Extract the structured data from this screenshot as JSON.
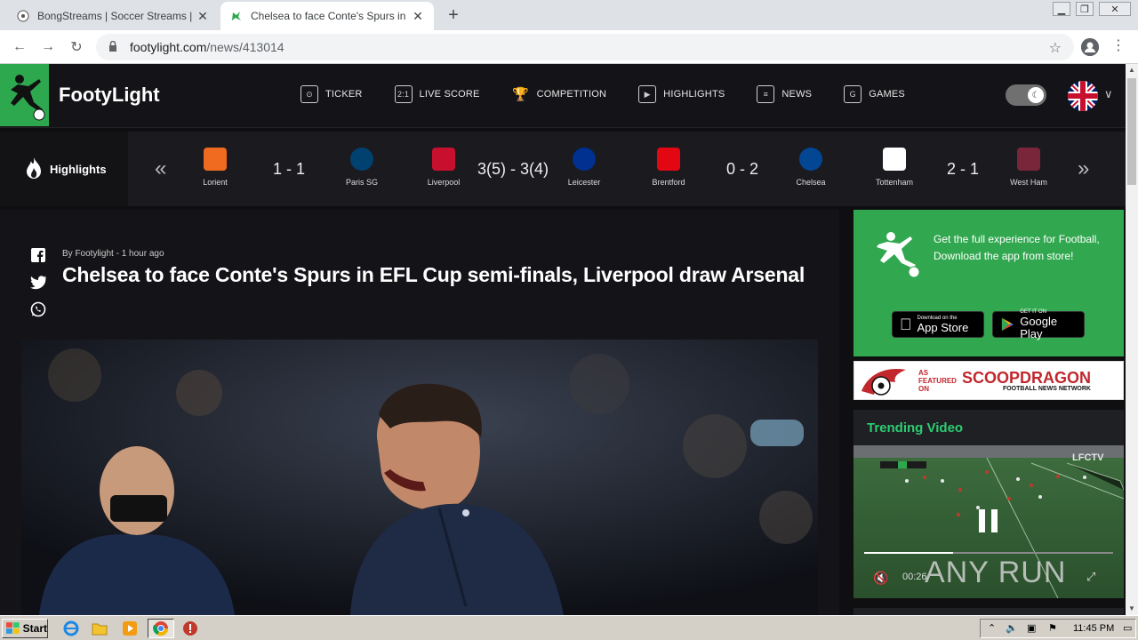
{
  "browser": {
    "tabs": [
      {
        "title": "BongStreams | Soccer Streams | NBA",
        "active": false
      },
      {
        "title": "Chelsea to face Conte's Spurs in EFL",
        "active": true
      }
    ],
    "new_tab_symbol": "+",
    "url_host": "footylight.com",
    "url_path": "/news/413014"
  },
  "site": {
    "brand": "FootyLight",
    "accent_color": "#2ea84f",
    "nav": [
      {
        "label": "TICKER",
        "icon": "ticker-icon"
      },
      {
        "label": "LIVE SCORE",
        "icon": "live-score-icon"
      },
      {
        "label": "COMPETITION",
        "icon": "trophy-icon"
      },
      {
        "label": "HIGHLIGHTS",
        "icon": "play-icon"
      },
      {
        "label": "NEWS",
        "icon": "news-icon"
      },
      {
        "label": "GAMES",
        "icon": "games-icon"
      }
    ]
  },
  "highlights": {
    "label": "Highlights",
    "matches": [
      {
        "home": "Lorient",
        "away": "Paris SG",
        "score": "1 - 1",
        "home_color": "#f06a1f",
        "away_color": "#004170"
      },
      {
        "home": "Liverpool",
        "away": "Leicester",
        "score": "3(5) - 3(4)",
        "home_color": "#c8102e",
        "away_color": "#003090"
      },
      {
        "home": "Brentford",
        "away": "Chelsea",
        "score": "0 - 2",
        "home_color": "#e30613",
        "away_color": "#034694"
      },
      {
        "home": "Tottenham",
        "away": "West Ham",
        "score": "2 - 1",
        "home_color": "#ffffff",
        "away_color": "#7a263a"
      }
    ]
  },
  "article": {
    "byline": "By Footylight - 1 hour ago",
    "headline": "Chelsea to face Conte's Spurs in EFL Cup semi-finals, Liverpool draw Arsenal"
  },
  "sidebar": {
    "promo_text": "Get the full experience for Football, Download the app from store!",
    "app_store": {
      "small": "Download on the",
      "big": "App Store"
    },
    "google_play": {
      "small": "GET IT ON",
      "big": "Google Play"
    },
    "scoop": {
      "tag_line1": "AS",
      "tag_line2": "FEATURED",
      "tag_line3": "ON",
      "name": "SCOOPDRAGON",
      "sub": "FOOTBALL NEWS NETWORK"
    },
    "trending_title": "Trending Video",
    "video": {
      "time": "00:26",
      "overlay_channel": "LFCTV",
      "watermark": "ANY RUN"
    }
  },
  "taskbar": {
    "start": "Start",
    "clock": "11:45 PM"
  }
}
